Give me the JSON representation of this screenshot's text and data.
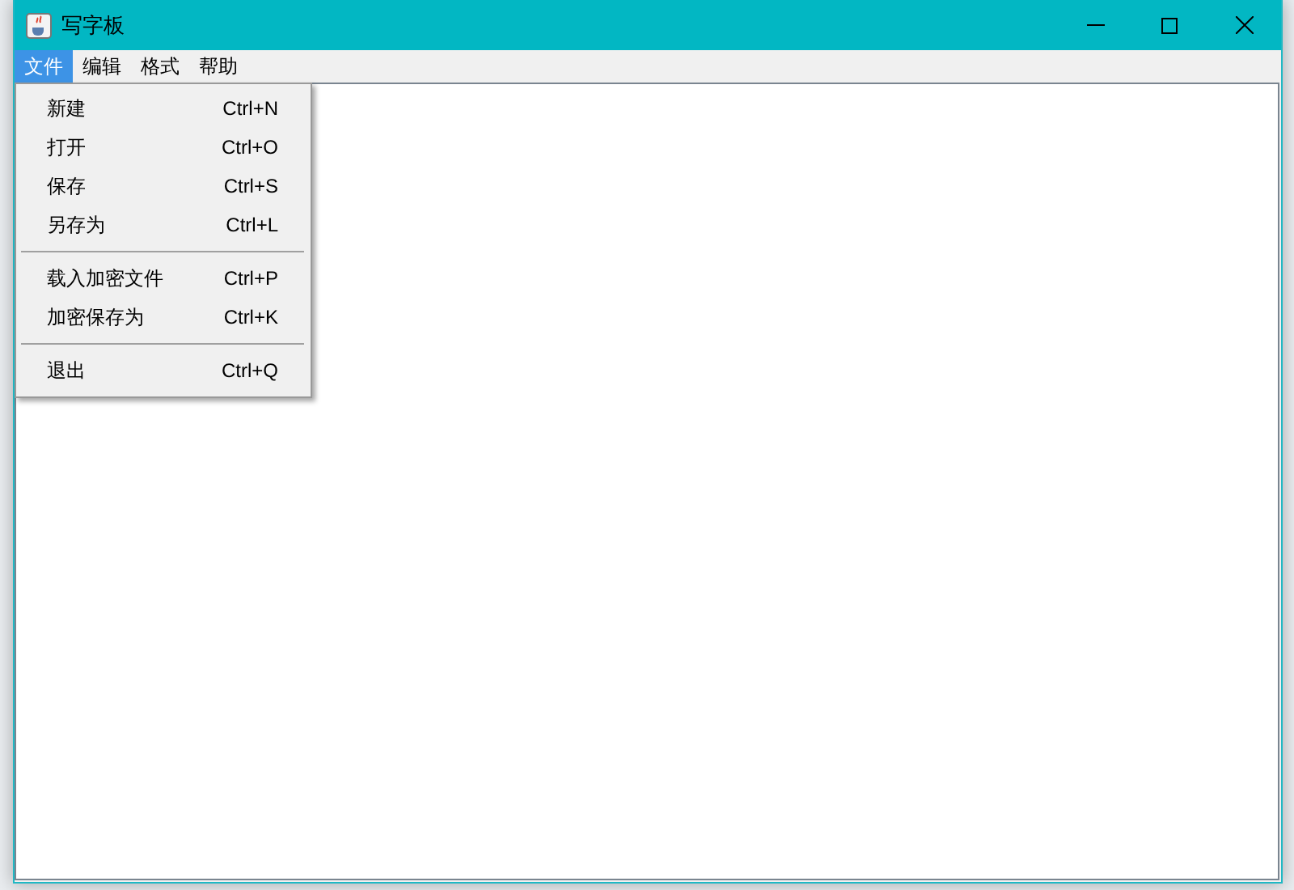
{
  "window": {
    "title": "写字板"
  },
  "menu_bar": [
    {
      "label": "文件",
      "selected": true
    },
    {
      "label": "编辑",
      "selected": false
    },
    {
      "label": "格式",
      "selected": false
    },
    {
      "label": "帮助",
      "selected": false
    }
  ],
  "open_menu": [
    {
      "kind": "item",
      "label": "新建",
      "shortcut": "Ctrl+N"
    },
    {
      "kind": "item",
      "label": "打开",
      "shortcut": "Ctrl+O"
    },
    {
      "kind": "item",
      "label": "保存",
      "shortcut": "Ctrl+S"
    },
    {
      "kind": "item",
      "label": "另存为",
      "shortcut": "Ctrl+L"
    },
    {
      "kind": "separator"
    },
    {
      "kind": "item",
      "label": "载入加密文件",
      "shortcut": "Ctrl+P"
    },
    {
      "kind": "item",
      "label": "加密保存为",
      "shortcut": "Ctrl+K"
    },
    {
      "kind": "separator"
    },
    {
      "kind": "item",
      "label": "退出",
      "shortcut": "Ctrl+Q"
    }
  ]
}
